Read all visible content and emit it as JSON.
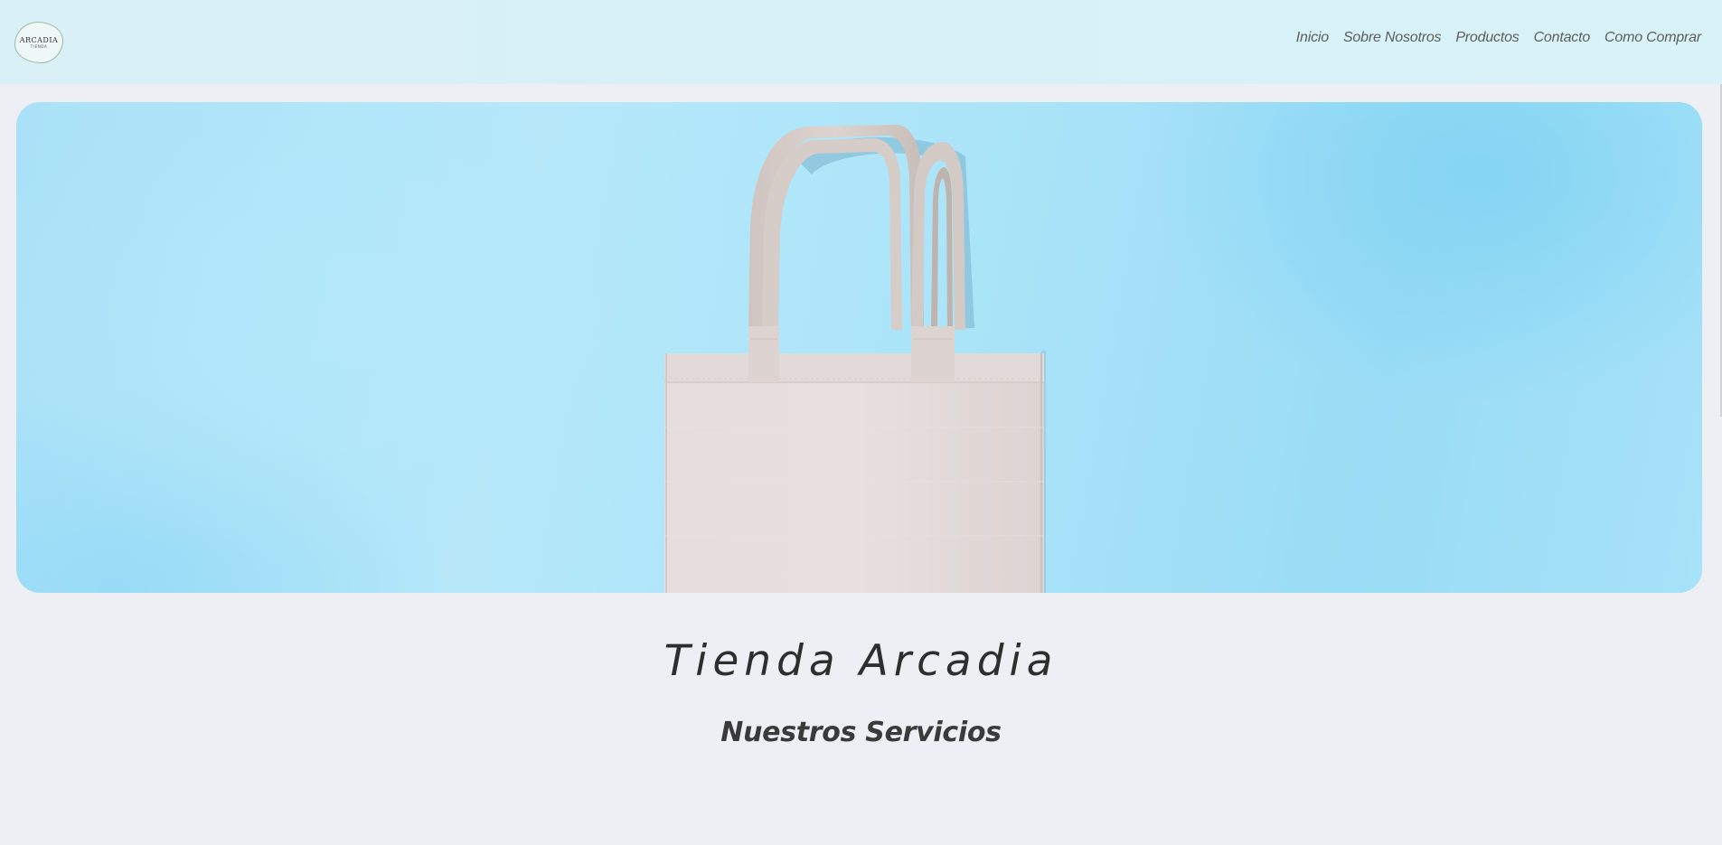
{
  "header": {
    "logo": {
      "main": "ARCADIA",
      "sub": "TIENDA"
    },
    "nav": [
      {
        "label": "Inicio"
      },
      {
        "label": "Sobre Nosotros"
      },
      {
        "label": "Productos"
      },
      {
        "label": "Contacto"
      },
      {
        "label": "Como Comprar"
      }
    ]
  },
  "hero": {
    "image": "tote-bag-image"
  },
  "main": {
    "title": "Tienda Arcadia",
    "subtitle": "Nuestros Servicios"
  },
  "colors": {
    "header_bg": "#d8f1f7",
    "page_bg": "#eeeff4",
    "hero_blue": "#abe4f9",
    "tote_canvas": "#e4dcda"
  }
}
